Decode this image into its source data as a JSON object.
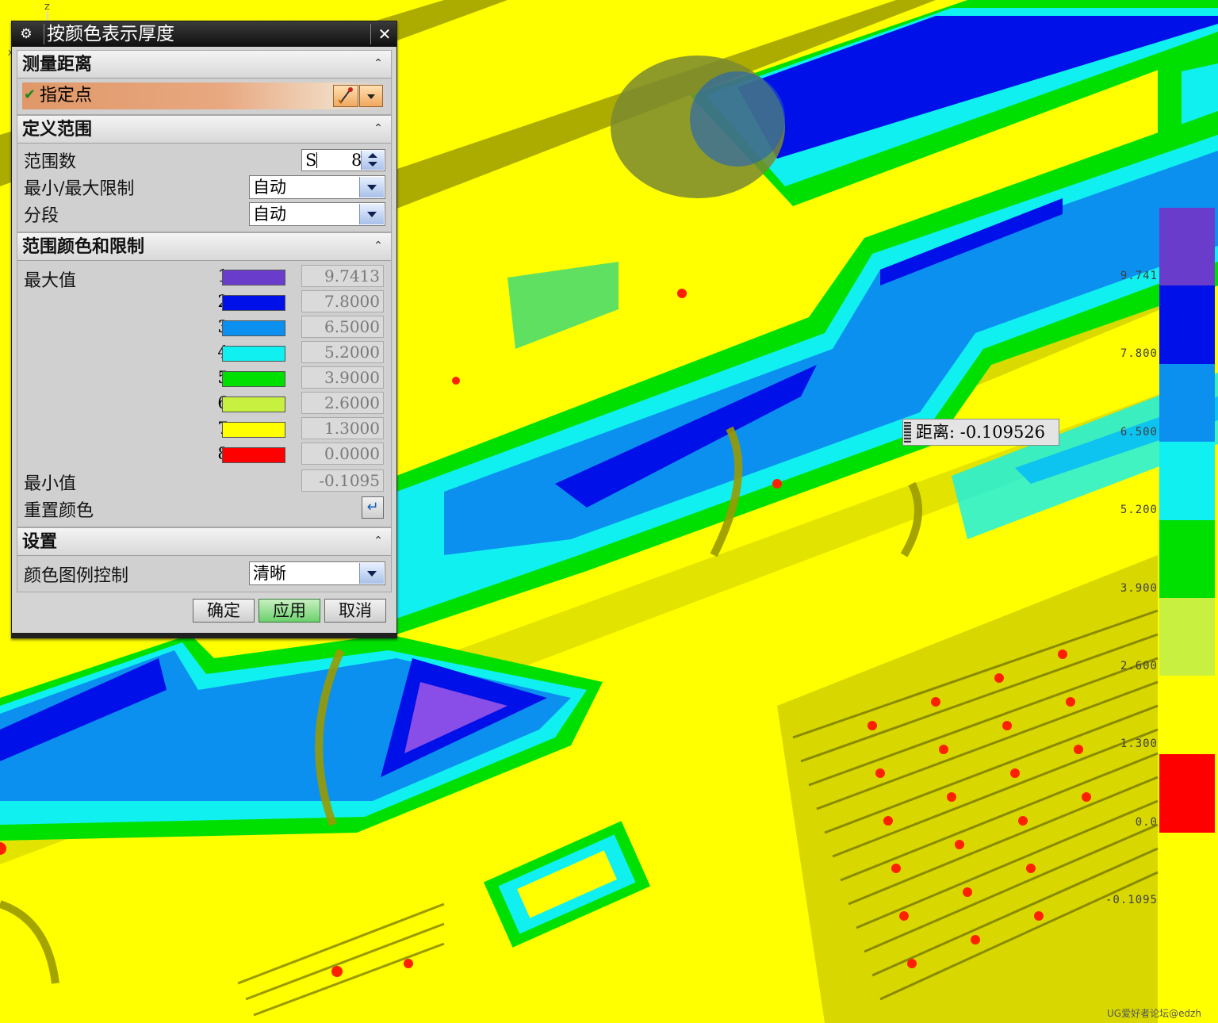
{
  "dialog": {
    "title": "按颜色表示厚度",
    "sections": {
      "measure": "测量距离",
      "range": "定义范围",
      "colors": "范围颜色和限制",
      "settings": "设置"
    },
    "specify_point": "指定点",
    "range_count_label": "范围数",
    "range_count_value": "S",
    "range_count_tail": "8",
    "minmax_label": "最小/最大限制",
    "minmax_value": "自动",
    "segment_label": "分段",
    "segment_value": "自动",
    "max_label": "最大值",
    "min_label": "最小值",
    "min_value": "-0.1095",
    "reset_color_label": "重置颜色",
    "legend_control_label": "颜色图例控制",
    "legend_control_value": "清晰",
    "ranges": [
      {
        "index": "1",
        "color": "#6a3ccc",
        "limit": "9.7413"
      },
      {
        "index": "2",
        "color": "#0010e8",
        "limit": "7.8000"
      },
      {
        "index": "3",
        "color": "#0c90f0",
        "limit": "6.5000"
      },
      {
        "index": "4",
        "color": "#10f0f0",
        "limit": "5.2000"
      },
      {
        "index": "5",
        "color": "#00e000",
        "limit": "3.9000"
      },
      {
        "index": "6",
        "color": "#c8f040",
        "limit": "2.6000"
      },
      {
        "index": "7",
        "color": "#ffff00",
        "limit": "1.3000"
      },
      {
        "index": "8",
        "color": "#ff0000",
        "limit": "0.0000"
      }
    ],
    "buttons": {
      "ok": "确定",
      "apply": "应用",
      "cancel": "取消"
    }
  },
  "legend": {
    "labels": [
      "9.741",
      "7.800",
      "6.500",
      "5.200",
      "3.900",
      "2.600",
      "1.300",
      "0.0",
      "-0.1095"
    ],
    "colors": [
      "#6a3ccc",
      "#0010e8",
      "#0c90f0",
      "#10f0f0",
      "#00e000",
      "#c8f040",
      "#ffff00",
      "#ff0000"
    ]
  },
  "distance_tip": "距离: -0.109526",
  "watermark": "UG爱好者论坛@edzh",
  "icons": [
    "gear-icon",
    "close-icon",
    "check-icon",
    "point-dialog-icon",
    "dropdown-icon",
    "collapse-icon",
    "reset-icon",
    "spinner-icon",
    "wcs-triad-icon"
  ]
}
